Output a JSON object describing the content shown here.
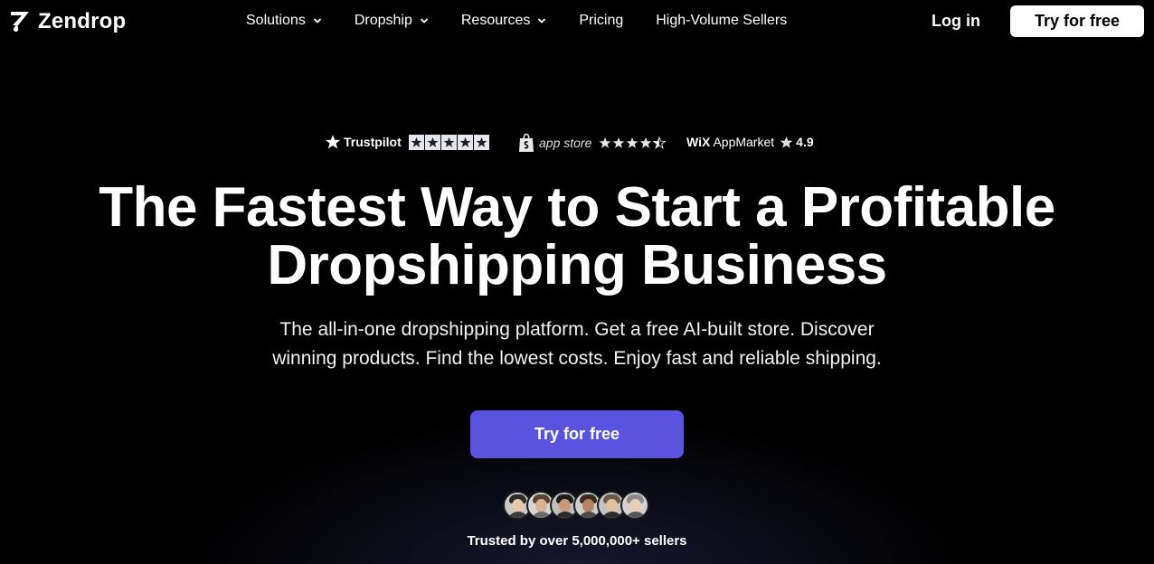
{
  "brand": {
    "name": "Zendrop"
  },
  "nav": {
    "links": [
      {
        "label": "Solutions",
        "has_dropdown": true
      },
      {
        "label": "Dropship",
        "has_dropdown": true
      },
      {
        "label": "Resources",
        "has_dropdown": true
      },
      {
        "label": "Pricing",
        "has_dropdown": false
      },
      {
        "label": "High-Volume Sellers",
        "has_dropdown": false
      }
    ],
    "login_label": "Log in",
    "cta_label": "Try for free"
  },
  "ratings": {
    "trustpilot": {
      "name": "Trustpilot",
      "stars": 5
    },
    "appstore": {
      "name": "app store",
      "stars": 4.5
    },
    "wix": {
      "brand": "WiX",
      "market": "AppMarket",
      "score": "4.9"
    }
  },
  "hero": {
    "headline_line1": "The Fastest Way to Start a Profitable",
    "headline_line2": "Dropshipping Business",
    "subtitle_line1": "The all-in-one dropshipping platform. Get a free AI-built store. Discover",
    "subtitle_line2": "winning products. Find the lowest costs. Enjoy fast and reliable shipping.",
    "cta_label": "Try for free"
  },
  "trust": {
    "text": "Trusted by over 5,000,000+ sellers",
    "avatar_count": 6
  },
  "colors": {
    "background": "#000000",
    "accent": "#5a53e0",
    "text": "#ffffff"
  }
}
